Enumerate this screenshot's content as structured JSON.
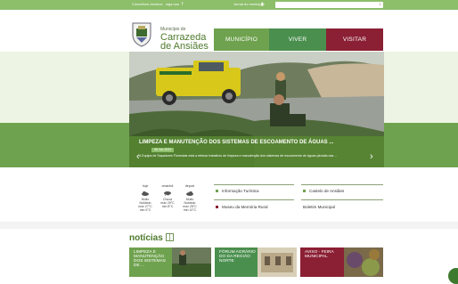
{
  "topbar": {
    "link1": "Concelhos vizinhos",
    "link2": "siga-nos",
    "link3": "Jornal do município",
    "search_placeholder": "pesquisar"
  },
  "header": {
    "brand_small": "Município de",
    "brand_line1": "Carrazeda",
    "brand_line2": "de Ansiães"
  },
  "nav": [
    {
      "label": "MUNICÍPIO",
      "color": "#6fa24f"
    },
    {
      "label": "VIVER",
      "color": "#4a8f4e"
    },
    {
      "label": "VISITAR",
      "color": "#8b1f34"
    }
  ],
  "hero": {
    "title": "LIMPEZA E MANUTENÇÃO DOS SISTEMAS DE ESCOAMENTO DE ÁGUAS ...",
    "date": "08 Jun 2022",
    "text": "A Equipa de Sapadores Florestais está a efetuar trabalhos de limpeza e manutenção dos sistemas de escoamento de águas pluviais nas ..."
  },
  "weather": [
    {
      "day": "hoje",
      "cond": "Muito Nublado",
      "max": "max 27°C",
      "min": "min 9°C"
    },
    {
      "day": "amanhã",
      "cond": "Chuva",
      "max": "max 25°C",
      "min": "min 8°C"
    },
    {
      "day": "depois",
      "cond": "Muito Nublado",
      "max": "max 28°C",
      "min": "min 10°C"
    }
  ],
  "quick_links": [
    {
      "label": "Informação Turística",
      "color": "#6fa24f"
    },
    {
      "label": "Castelo de Ansiães",
      "color": "#6fa24f"
    },
    {
      "label": "Museu da Memória Rural",
      "color": "#8b1f34"
    },
    {
      "label": "Boletim Municipal",
      "color": ""
    }
  ],
  "news": {
    "title": "notícias",
    "cards": [
      {
        "text": "LIMPEZA E MANUTENÇÃO DOS SISTEMAS DE ...",
        "color": "#6fa24f"
      },
      {
        "text": "FÓRUM AGRÁRIO DO DA REGIÃO NORTE",
        "color": "#4a8f4e"
      },
      {
        "text": "AVISO - FEIRA MUNICIPAL",
        "color": "#8b1f34"
      }
    ]
  }
}
